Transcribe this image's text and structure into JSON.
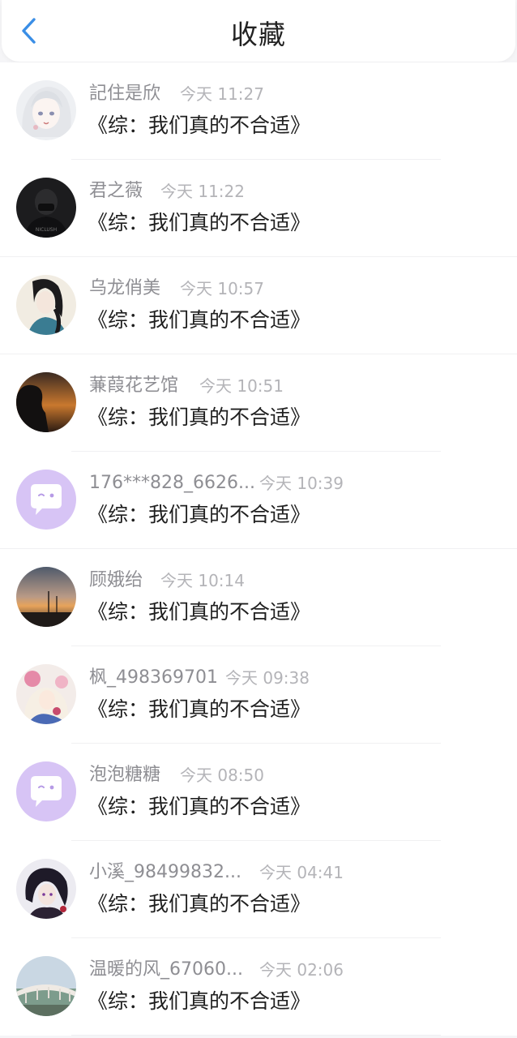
{
  "header": {
    "title": "收藏",
    "back_icon": "chevron-left-icon",
    "accent": "#3a8ee6"
  },
  "items": [
    {
      "name": "記住是欣",
      "time": "今天 11:27",
      "title": "《综：我们真的不合适》",
      "avatar": "anime-girl-white-hair"
    },
    {
      "name": "君之薇",
      "time": "今天 11:22",
      "title": "《综：我们真的不合适》",
      "avatar": "dark-figure-mask"
    },
    {
      "name": "乌龙俏美",
      "time": "今天 10:57",
      "title": "《综：我们真的不合适》",
      "avatar": "ink-painting-girl"
    },
    {
      "name": "蒹葭花艺馆",
      "time": "今天 10:51",
      "title": "《综：我们真的不合适》",
      "avatar": "silhouette-sunset"
    },
    {
      "name": "176***828_6626...",
      "time": "今天 10:39",
      "title": "《综：我们真的不合适》",
      "avatar": "default-chat-bubble"
    },
    {
      "name": "顾娥绐",
      "time": "今天 10:14",
      "title": "《综：我们真的不合适》",
      "avatar": "sky-sunset-streetlight"
    },
    {
      "name": "枫_498369701",
      "time": "今天 09:38",
      "title": "《综：我们真的不合适》",
      "avatar": "anime-flower-girl"
    },
    {
      "name": "泡泡糖糖",
      "time": "今天 08:50",
      "title": "《综：我们真的不合适》",
      "avatar": "default-chat-bubble"
    },
    {
      "name": "小溪_98499832...",
      "time": "今天 04:41",
      "title": "《综：我们真的不合适》",
      "avatar": "anime-dark-hair-boy"
    },
    {
      "name": "温暖的风_67060...",
      "time": "今天 02:06",
      "title": "《综：我们真的不合适》",
      "avatar": "bridge-landscape"
    }
  ]
}
